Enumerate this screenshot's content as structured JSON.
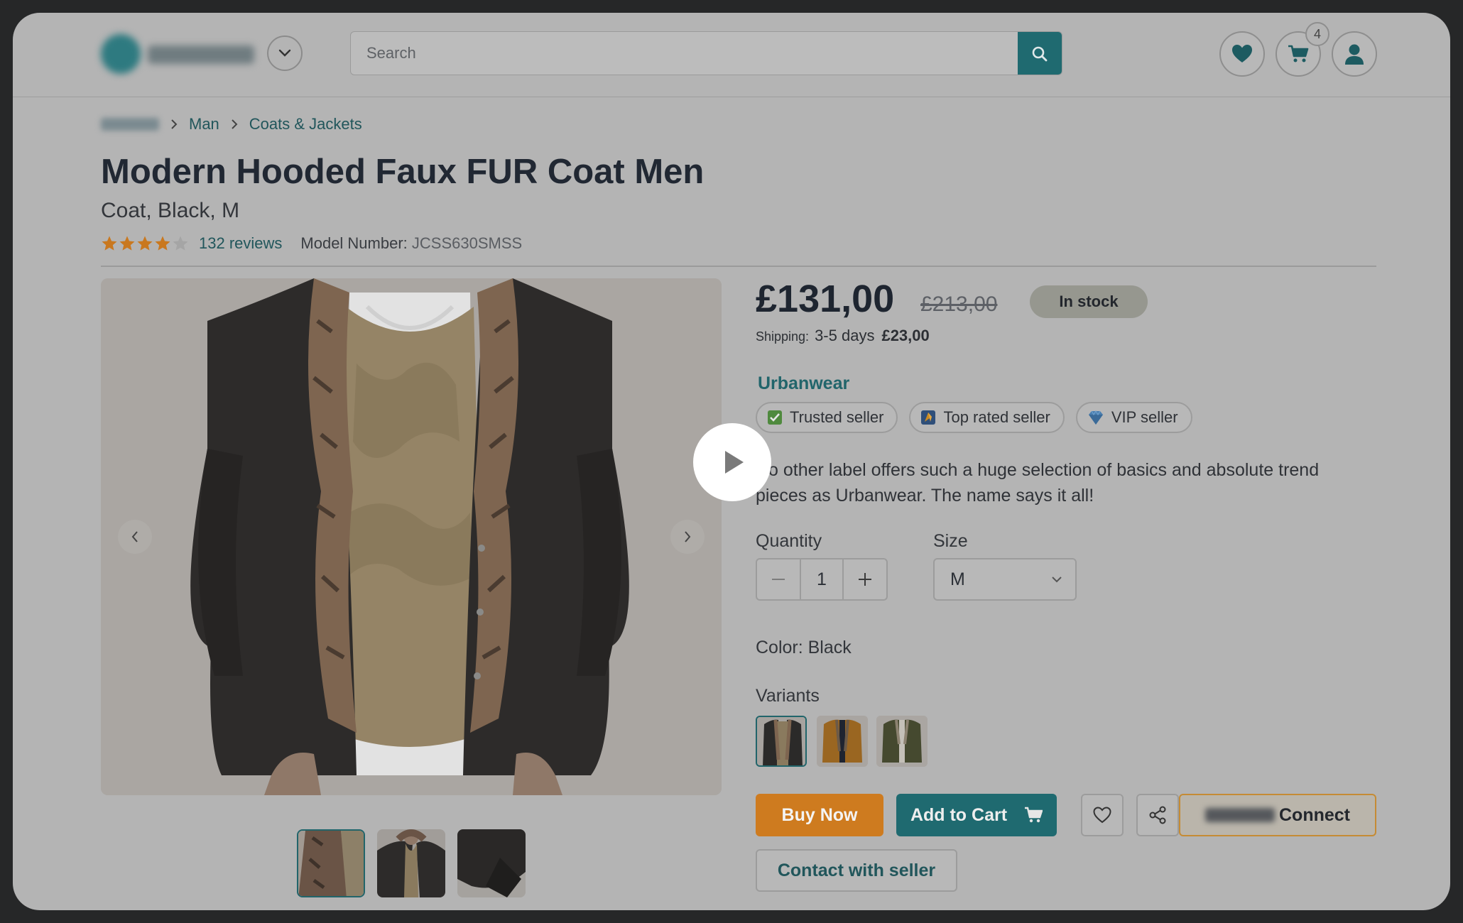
{
  "header": {
    "search_placeholder": "Search",
    "cart_count": "4"
  },
  "breadcrumb": {
    "items": [
      "Man",
      "Coats & Jackets"
    ]
  },
  "product": {
    "title": "Modern Hooded Faux FUR Coat Men",
    "subtitle": "Coat, Black, M",
    "rating": 4,
    "rating_max": 5,
    "reviews": "132 reviews",
    "model_label": "Model Number:",
    "model_value": "JCSS630SMSS"
  },
  "pricing": {
    "price": "£131,00",
    "old_price": "£213,00",
    "stock": "In stock",
    "shipping_label": "Shipping:",
    "shipping_time": "3-5 days",
    "shipping_cost": "£23,00"
  },
  "seller": {
    "name": "Urbanwear",
    "badges": [
      "Trusted seller",
      "Top rated seller",
      "VIP seller"
    ],
    "description": "No other label offers such a huge selection of basics and absolute trend pieces as Urbanwear. The name says it all!"
  },
  "options": {
    "quantity_label": "Quantity",
    "quantity_value": "1",
    "size_label": "Size",
    "size_value": "M",
    "color_line": "Color: Black",
    "variants_label": "Variants"
  },
  "actions": {
    "buy_now": "Buy Now",
    "add_to_cart": "Add to Cart",
    "connect": "Connect",
    "contact": "Contact with seller"
  },
  "colors": {
    "accent": "#1f6a70",
    "buy": "#ce7b1f",
    "star": "#c9781f",
    "overlay_bg": "#b4b4b4"
  }
}
